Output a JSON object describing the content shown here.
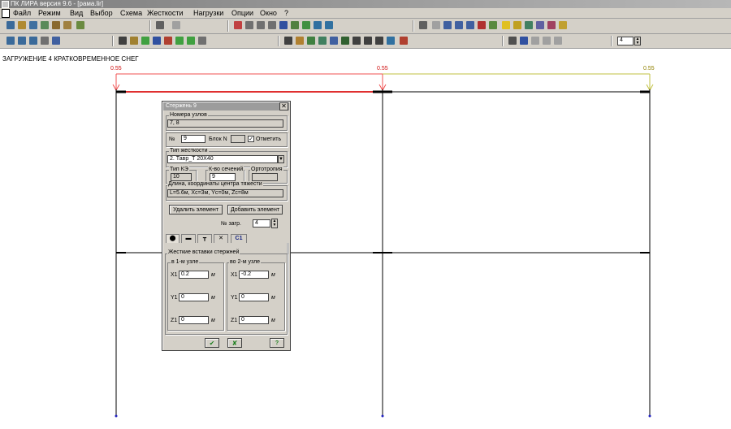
{
  "window": {
    "title": "ПК ЛИРА  версия 9.6 - [рама.lir]"
  },
  "menu": [
    "Файл",
    "Режим",
    "Вид",
    "Выбор",
    "Схема",
    "Жесткости",
    "Нагрузки",
    "Опции",
    "Окно",
    "?"
  ],
  "toolbar": {
    "spin_value": "4"
  },
  "caption": "ЗАГРУЖЕНИЕ 4 КРАТКОВРЕМЕННОЕ СНЕГ",
  "load_labels": [
    "0.55",
    "0.55",
    "0.55"
  ],
  "colors": {
    "load_red": "#f05050",
    "load_olive": "#c0c040",
    "frame": "#000000",
    "dialog_bg": "#d4d0c8"
  },
  "dialog": {
    "title": "Стержень  9",
    "nodes_label": "Номера узлов",
    "nodes_value": "7, 8",
    "num_label": "№",
    "num_value": "9",
    "block_label": "Блок N",
    "block_value": "",
    "mark_label": "Отметить",
    "mark_checked": "✓",
    "stiff_type_label": "Тип жесткости",
    "stiff_type_value": "2. Тавр_Т 20Х40",
    "fe_type_label": "Тип КЭ",
    "fe_type_value": "10",
    "sections_label": "К-во сечений",
    "sections_value": "9",
    "ortho_label": "Ортотропия",
    "ortho_value": "",
    "length_label": "Длина, координаты центра тяжести",
    "length_value": "L=5.6м, Xc=3м, Yc=0м, Zc=8м",
    "delete_button": "Удалить элемент",
    "add_button": "Добавить элемент",
    "load_num_label": "№ загр.",
    "load_num_value": "4",
    "tab_c1": "C1",
    "rigid_label": "Жесткие вставки стержней",
    "node1_label": "в 1-м узле",
    "node2_label": "во 2-м узле",
    "x1_label": "X1",
    "y1_label": "Y1",
    "z1_label": "Z1",
    "unit": "м",
    "node1": {
      "x1": "0.2",
      "y1": "0",
      "z1": "0"
    },
    "node2": {
      "x1": "-0.2",
      "y1": "0",
      "z1": "0"
    },
    "help_button": "?"
  }
}
